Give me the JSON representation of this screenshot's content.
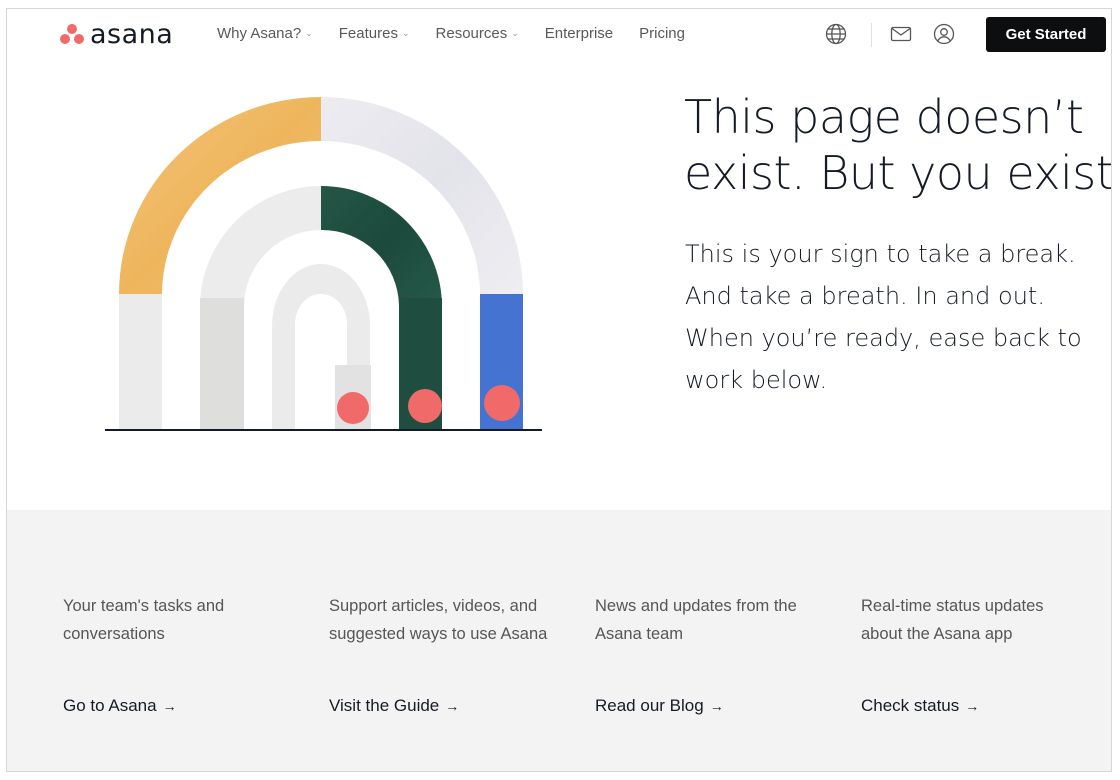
{
  "header": {
    "logo_text": "asana",
    "nav": [
      {
        "label": "Why Asana?",
        "dropdown": true
      },
      {
        "label": "Features",
        "dropdown": true
      },
      {
        "label": "Resources",
        "dropdown": true
      },
      {
        "label": "Enterprise",
        "dropdown": false
      },
      {
        "label": "Pricing",
        "dropdown": false
      }
    ],
    "icons": [
      "globe-icon",
      "mail-icon",
      "user-icon"
    ],
    "cta_label": "Get Started"
  },
  "hero": {
    "headline_line1": "This page doesn’t",
    "headline_line2": "exist. But you exist.",
    "sub_line1": "This is your sign to take a break.",
    "sub_line2": "And take a breath. In and out.",
    "sub_line3": "When you’re ready, ease back to",
    "sub_line4": "work below."
  },
  "links": [
    {
      "desc_line1": "Your team's tasks and",
      "desc_line2": "conversations",
      "link": "Go to Asana"
    },
    {
      "desc_line1": "Support articles, videos, and",
      "desc_line2": "suggested ways to use Asana",
      "link": "Visit the Guide"
    },
    {
      "desc_line1": "News and updates from the",
      "desc_line2": "Asana team",
      "link": "Read our Blog"
    },
    {
      "desc_line1": "Real-time status updates",
      "desc_line2": "about the Asana app",
      "link": "Check status"
    }
  ],
  "colors": {
    "brand_coral": "#f06a6a",
    "arch_yellow": "#f1bd6c",
    "arch_green": "#1f4d3f",
    "arch_blue": "#4573d2",
    "cta_bg": "#0d0e10",
    "band_bg": "#f4f3f3"
  }
}
